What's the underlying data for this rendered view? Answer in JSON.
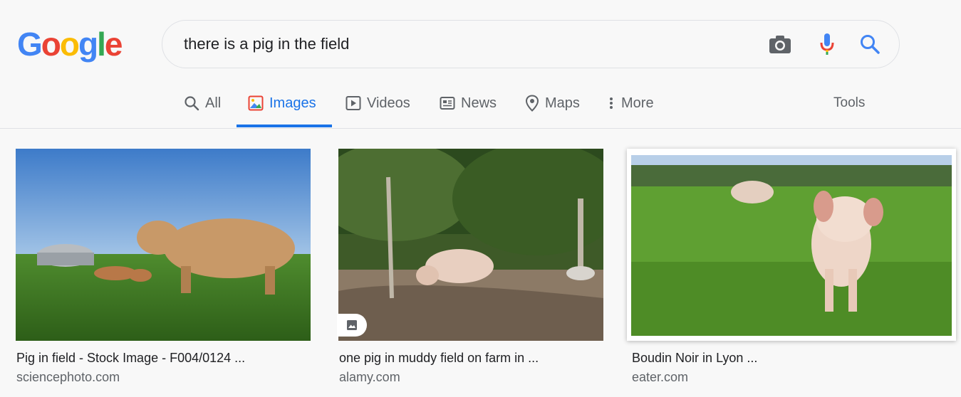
{
  "logo": {
    "letters": [
      "G",
      "o",
      "o",
      "g",
      "l",
      "e"
    ],
    "colors": [
      "#4285f4",
      "#ea4335",
      "#fbbc05",
      "#4285f4",
      "#34a853",
      "#ea4335"
    ]
  },
  "search": {
    "query": "there is a pig in the field"
  },
  "icons": {
    "camera": "camera-icon",
    "mic": "mic-icon",
    "search": "search-icon"
  },
  "tabs": [
    {
      "label": "All",
      "icon": "search-icon"
    },
    {
      "label": "Images",
      "icon": "image-icon",
      "active": true
    },
    {
      "label": "Videos",
      "icon": "play-icon"
    },
    {
      "label": "News",
      "icon": "news-icon"
    },
    {
      "label": "Maps",
      "icon": "map-pin-icon"
    },
    {
      "label": "More",
      "icon": "more-vert-icon"
    }
  ],
  "tools_label": "Tools",
  "results": [
    {
      "caption": "Pig in field - Stock Image - F004/0124 ...",
      "source": "sciencephoto.com"
    },
    {
      "caption": "one pig in muddy field on farm in ...",
      "source": "alamy.com"
    },
    {
      "caption": "Boudin Noir in Lyon ...",
      "source": "eater.com"
    }
  ],
  "colors": {
    "accent": "#1a73e8",
    "muted": "#5f6368"
  }
}
